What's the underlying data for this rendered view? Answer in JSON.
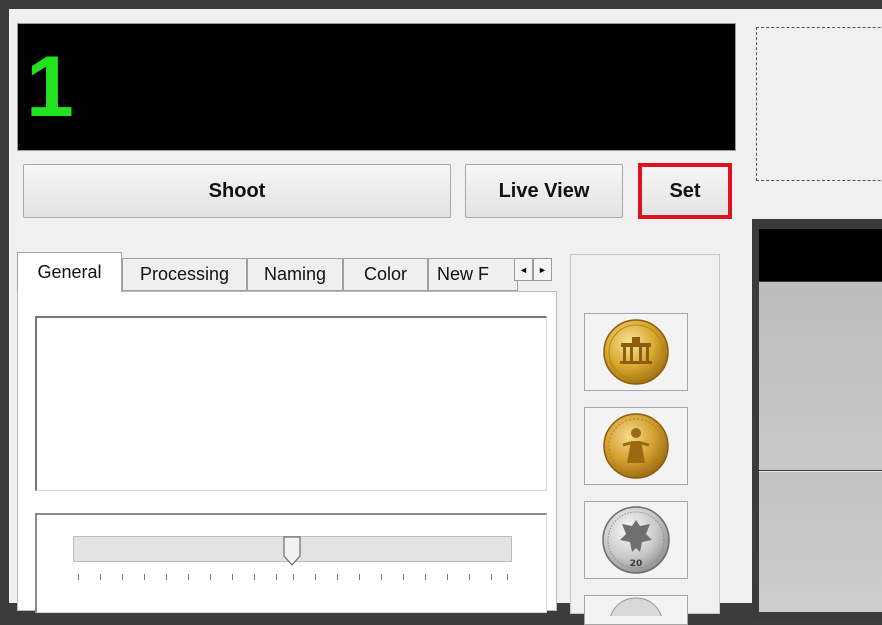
{
  "counter": {
    "value": "1",
    "color": "#22e31f"
  },
  "buttons": {
    "shoot": "Shoot",
    "live_view": "Live View",
    "set": "Set"
  },
  "highlight_color": "#e0141f",
  "tabs": [
    {
      "label": "General",
      "active": true
    },
    {
      "label": "Processing",
      "active": false
    },
    {
      "label": "Naming",
      "active": false
    },
    {
      "label": "Color",
      "active": false
    },
    {
      "label": "New F",
      "active": false
    }
  ],
  "tab_scroll": {
    "left": "◄",
    "right": "►"
  },
  "coins": [
    {
      "icon": "gold-coin-brandenburg-gate-icon"
    },
    {
      "icon": "gold-coin-figure-icon"
    },
    {
      "icon": "silver-coin-eagle-20-icon",
      "text": "20"
    },
    {
      "icon": "coin-icon"
    }
  ]
}
